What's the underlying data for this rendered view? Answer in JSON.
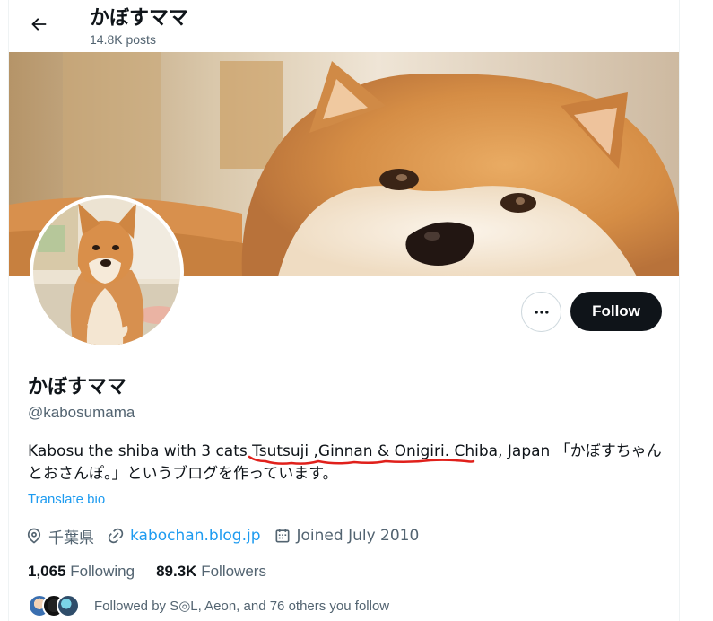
{
  "header": {
    "title": "かぼすママ",
    "posts": "14.8K posts"
  },
  "profile": {
    "name": "かぼすママ",
    "handle": "@kabosumama",
    "bio": "Kabosu the shiba with 3 cats Tsutsuji ,Ginnan & Onigiri. Chiba, Japan 「かぼすちゃんとおさんぽ。」というブログを作っています。",
    "translate_label": "Translate bio",
    "location": "千葉県",
    "website": "kabochan.blog.jp",
    "joined": "Joined July 2010"
  },
  "actions": {
    "follow_label": "Follow",
    "more_icon": "more-horizontal-icon"
  },
  "stats": {
    "following_count": "1,065",
    "following_label": "Following",
    "followers_count": "89.3K",
    "followers_label": "Followers"
  },
  "followed_by": {
    "text": "Followed by S◎L, Aeon, and 76 others you follow"
  },
  "colors": {
    "accent": "#1d9bf0",
    "text_primary": "#0f1419",
    "text_secondary": "#536471",
    "annotation": "#e0201b"
  },
  "icons": {
    "back": "arrow-left-icon",
    "location": "location-pin-icon",
    "link": "link-icon",
    "calendar": "calendar-icon"
  }
}
